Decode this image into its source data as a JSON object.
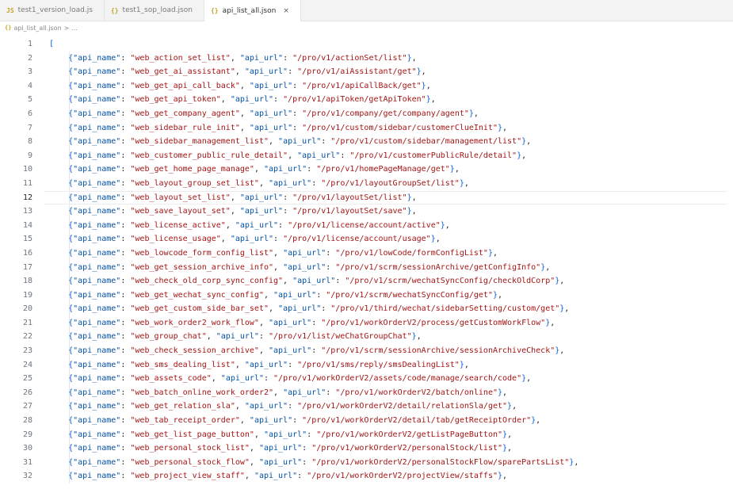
{
  "tabs": [
    {
      "label": "test1_version_load.js",
      "icon": "js-file-icon",
      "active": false
    },
    {
      "label": "test1_sop_load.json",
      "icon": "json-file-icon",
      "active": false
    },
    {
      "label": "api_list_all.json",
      "icon": "json-file-icon",
      "active": true
    }
  ],
  "breadcrumb": {
    "file": "api_list_all.json",
    "separator": ">",
    "ellipsis": "..."
  },
  "editor": {
    "current_line": 12,
    "open_bracket_line": {
      "number": "1",
      "text": "["
    },
    "lines": [
      {
        "number": "2",
        "api_name": "\"web_action_set_list\"",
        "api_url": "\"/pro/v1/actionSet/list\""
      },
      {
        "number": "3",
        "api_name": "\"web_get_ai_assistant\"",
        "api_url": "\"/pro/v1/aiAssistant/get\""
      },
      {
        "number": "4",
        "api_name": "\"web_get_api_call_back\"",
        "api_url": "\"/pro/v1/apiCallBack/get\""
      },
      {
        "number": "5",
        "api_name": "\"web_get_api_token\"",
        "api_url": "\"/pro/v1/apiToken/getApiToken\""
      },
      {
        "number": "6",
        "api_name": "\"web_get_company_agent\"",
        "api_url": "\"/pro/v1/company/get/company/agent\""
      },
      {
        "number": "7",
        "api_name": "\"web_sidebar_rule_init\"",
        "api_url": "\"/pro/v1/custom/sidebar/customerClueInit\""
      },
      {
        "number": "8",
        "api_name": "\"web_sidebar_management_list\"",
        "api_url": "\"/pro/v1/custom/sidebar/management/list\""
      },
      {
        "number": "9",
        "api_name": "\"web_customer_public_rule_detail\"",
        "api_url": "\"/pro/v1/customerPublicRule/detail\""
      },
      {
        "number": "10",
        "api_name": "\"web_get_home_page_manage\"",
        "api_url": "\"/pro/v1/homePageManage/get\""
      },
      {
        "number": "11",
        "api_name": "\"web_layout_group_set_list\"",
        "api_url": "\"/pro/v1/layoutGroupSet/list\""
      },
      {
        "number": "12",
        "api_name": "\"web_layout_set_list\"",
        "api_url": "\"/pro/v1/layoutSet/list\""
      },
      {
        "number": "13",
        "api_name": "\"web_save_layout_set\"",
        "api_url": "\"/pro/v1/layoutSet/save\""
      },
      {
        "number": "14",
        "api_name": "\"web_license_active\"",
        "api_url": "\"/pro/v1/license/account/active\""
      },
      {
        "number": "15",
        "api_name": "\"web_license_usage\"",
        "api_url": "\"/pro/v1/license/account/usage\""
      },
      {
        "number": "16",
        "api_name": "\"web_lowcode_form_config_list\"",
        "api_url": "\"/pro/v1/lowCode/formConfigList\""
      },
      {
        "number": "17",
        "api_name": "\"web_get_session_archive_info\"",
        "api_url": "\"/pro/v1/scrm/sessionArchive/getConfigInfo\""
      },
      {
        "number": "18",
        "api_name": "\"web_check_old_corp_sync_config\"",
        "api_url": "\"/pro/v1/scrm/wechatSyncConfig/checkOldCorp\""
      },
      {
        "number": "19",
        "api_name": "\"web_get_wechat_sync_config\"",
        "api_url": "\"/pro/v1/scrm/wechatSyncConfig/get\""
      },
      {
        "number": "20",
        "api_name": "\"web_get_custom_side_bar_set\"",
        "api_url": "\"/pro/v1/third/wechat/sidebarSetting/custom/get\""
      },
      {
        "number": "21",
        "api_name": "\"web_work_order2_work_flow\"",
        "api_url": "\"/pro/v1/workOrderV2/process/getCustomWorkFlow\""
      },
      {
        "number": "22",
        "api_name": "\"web_group_chat\"",
        "api_url": "\"/pro/v1/list/weChatGroupChat\""
      },
      {
        "number": "23",
        "api_name": "\"web_check_session_archive\"",
        "api_url": "\"/pro/v1/scrm/sessionArchive/sessionArchiveCheck\""
      },
      {
        "number": "24",
        "api_name": "\"web_sms_dealing_list\"",
        "api_url": "\"/pro/v1/sms/reply/smsDealingList\""
      },
      {
        "number": "25",
        "api_name": "\"web_assets_code\"",
        "api_url": "\"/pro/v1/workOrderV2/assets/code/manage/search/code\""
      },
      {
        "number": "26",
        "api_name": "\"web_batch_online_work_order2\"",
        "api_url": "\"/pro/v1/workOrderV2/batch/online\""
      },
      {
        "number": "27",
        "api_name": "\"web_get_relation_sla\"",
        "api_url": "\"/pro/v1/workOrderV2/detail/relationSla/get\""
      },
      {
        "number": "28",
        "api_name": "\"web_tab_receipt_order\"",
        "api_url": "\"/pro/v1/workOrderV2/detail/tab/getReceiptOrder\""
      },
      {
        "number": "29",
        "api_name": "\"web_get_list_page_button\"",
        "api_url": "\"/pro/v1/workOrderV2/getListPageButton\""
      },
      {
        "number": "30",
        "api_name": "\"web_personal_stock_list\"",
        "api_url": "\"/pro/v1/workOrderV2/personalStock/list\""
      },
      {
        "number": "31",
        "api_name": "\"web_personal_stock_flow\"",
        "api_url": "\"/pro/v1/workOrderV2/personalStockFlow/sparePartsList\""
      },
      {
        "number": "32",
        "api_name": "\"web_project_view_staff\"",
        "api_url": "\"/pro/v1/workOrderV2/projectView/staffs\""
      }
    ],
    "tokens": {
      "key_name": "\"api_name\"",
      "key_url": "\"api_url\""
    }
  },
  "colors": {
    "string": "#a31515",
    "key": "#0451a5",
    "bracket": "#0b5fd6",
    "line_number": "#6e7681"
  }
}
